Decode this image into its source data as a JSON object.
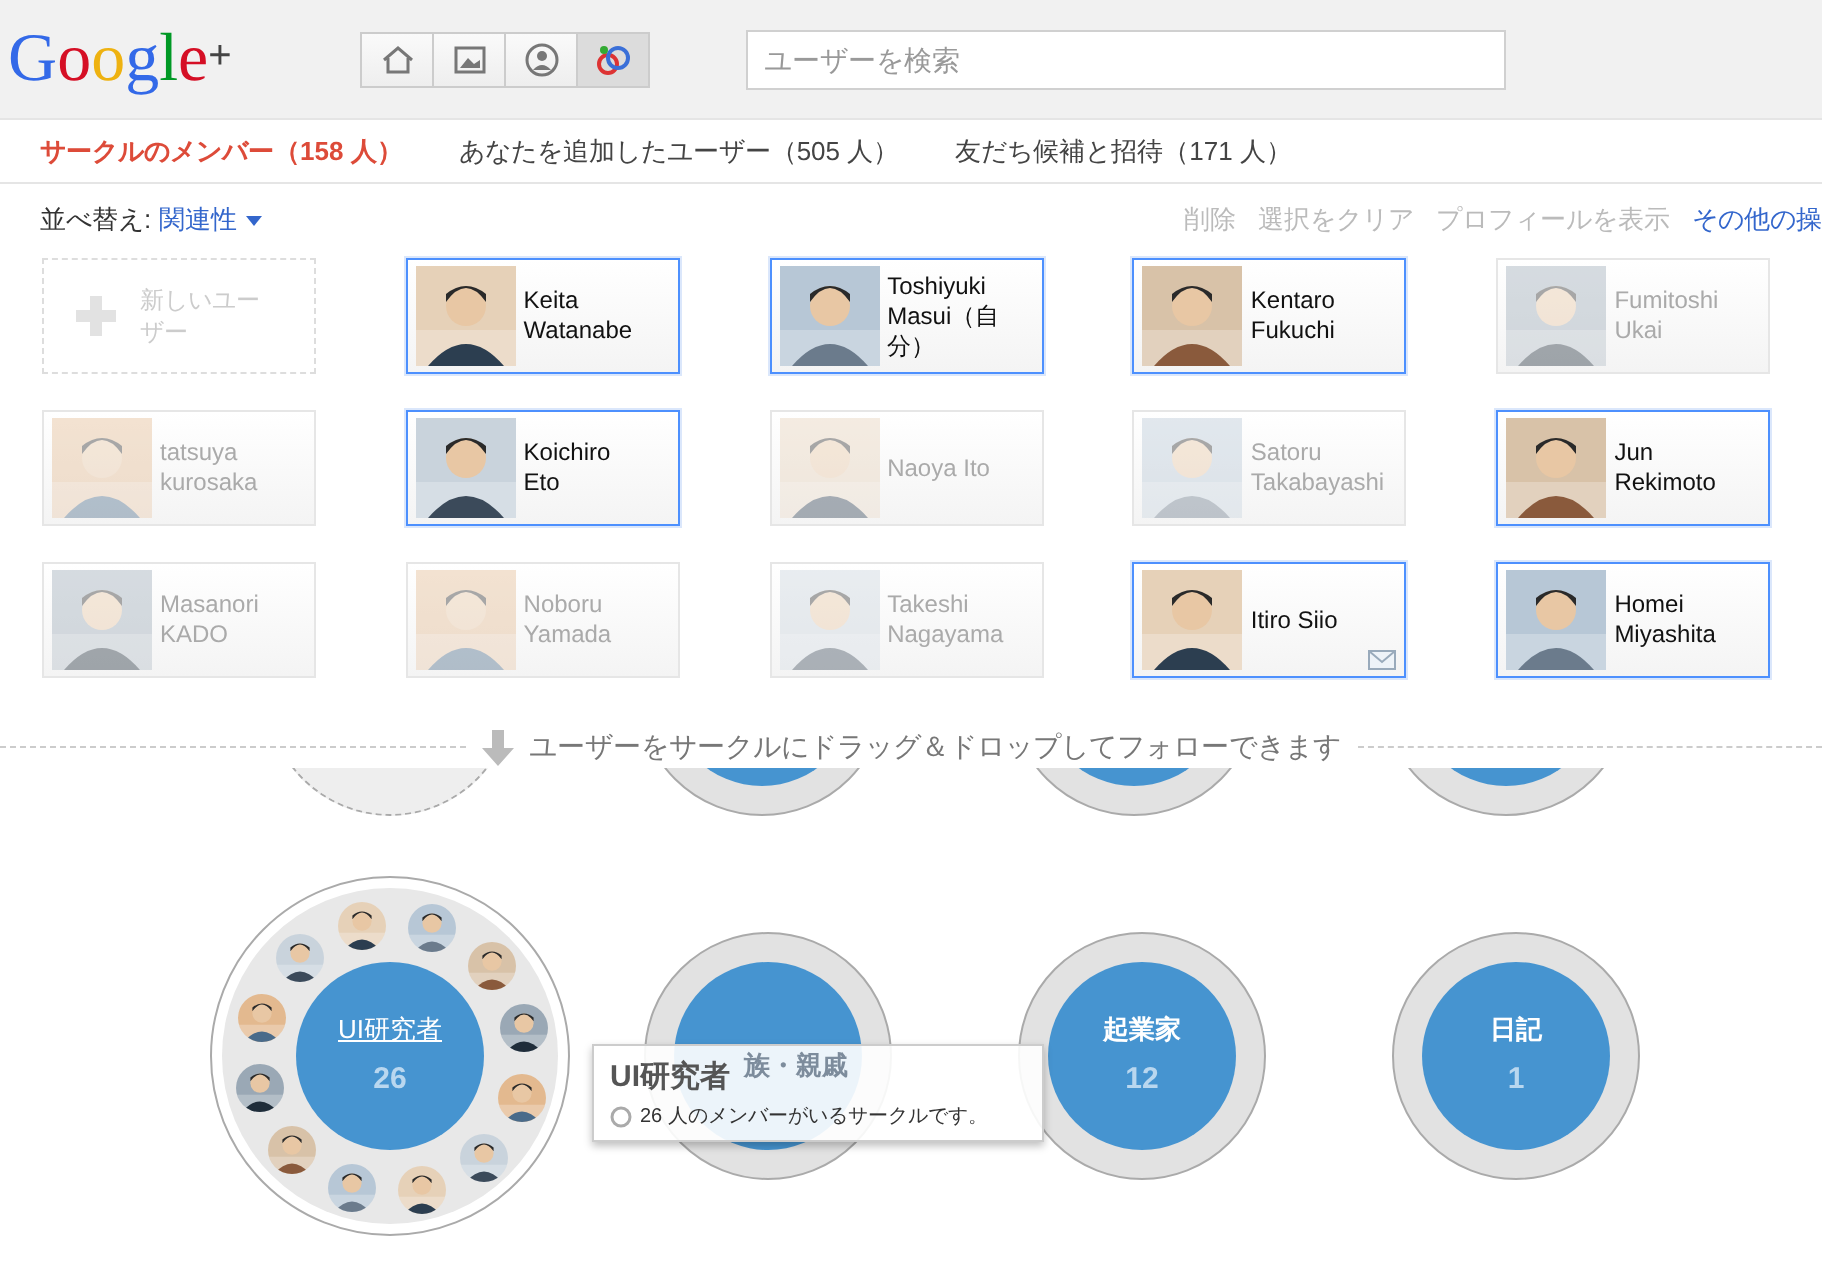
{
  "header": {
    "logo": "Google",
    "logo_plus": "+",
    "nav": [
      {
        "kind": "home",
        "selected": false
      },
      {
        "kind": "photos",
        "selected": false
      },
      {
        "kind": "profile",
        "selected": false
      },
      {
        "kind": "circles",
        "selected": true
      }
    ],
    "search": {
      "placeholder": "ユーザーを検索"
    }
  },
  "tabs": [
    {
      "label": "サークルのメンバー（158 人）",
      "selected": true
    },
    {
      "label": "あなたを追加したユーザー（505 人）",
      "selected": false
    },
    {
      "label": "友だち候補と招待（171 人）",
      "selected": false
    }
  ],
  "toolbar": {
    "sort_label": "並べ替え:",
    "sort_value": "関連性",
    "actions": [
      {
        "label": "削除",
        "disabled": true
      },
      {
        "label": "選択をクリア",
        "disabled": true
      },
      {
        "label": "プロフィールを表示",
        "disabled": true
      },
      {
        "label": "その他の操",
        "disabled": false
      }
    ]
  },
  "cards": [
    {
      "kind": "new",
      "name": "新しいユーザー",
      "selected": false,
      "mail": false
    },
    {
      "kind": "person",
      "name": "Keita\nWatanabe",
      "selected": true,
      "mail": false
    },
    {
      "kind": "person",
      "name": "Toshiyuki\nMasui（自分）",
      "selected": true,
      "mail": false
    },
    {
      "kind": "person",
      "name": "Kentaro\nFukuchi",
      "selected": true,
      "mail": false
    },
    {
      "kind": "person",
      "name": "Fumitoshi\nUkai",
      "selected": false,
      "mail": false
    },
    {
      "kind": "person",
      "name": "tatsuya\nkurosaka",
      "selected": false,
      "mail": false
    },
    {
      "kind": "person",
      "name": "Koichiro\nEto",
      "selected": true,
      "mail": false
    },
    {
      "kind": "person",
      "name": "Naoya Ito",
      "selected": false,
      "mail": false
    },
    {
      "kind": "person",
      "name": "Satoru\nTakabayashi",
      "selected": false,
      "mail": false
    },
    {
      "kind": "person",
      "name": "Jun\nRekimoto",
      "selected": true,
      "mail": false
    },
    {
      "kind": "person",
      "name": "Masanori\nKADO",
      "selected": false,
      "mail": false
    },
    {
      "kind": "person",
      "name": "Noboru\nYamada",
      "selected": false,
      "mail": false
    },
    {
      "kind": "person",
      "name": "Takeshi\nNagayama",
      "selected": false,
      "mail": false
    },
    {
      "kind": "person",
      "name": "Itiro Siio",
      "selected": true,
      "mail": true
    },
    {
      "kind": "person",
      "name": "Homei\nMiyashita",
      "selected": true,
      "mail": false
    }
  ],
  "drop_hint": "ユーザーをサークルにドラッグ＆ドロップしてフォローできます",
  "circles": [
    {
      "name": "UI研究者",
      "count": "26",
      "expanded": true
    },
    {
      "name": "族・親戚",
      "expanded": false
    },
    {
      "name": "起業家",
      "count": "12",
      "expanded": false
    },
    {
      "name": "日記",
      "count": "1",
      "expanded": false
    }
  ],
  "tooltip": {
    "title": "UI研究者",
    "text": "26 人のメンバーがいるサークルです。"
  }
}
